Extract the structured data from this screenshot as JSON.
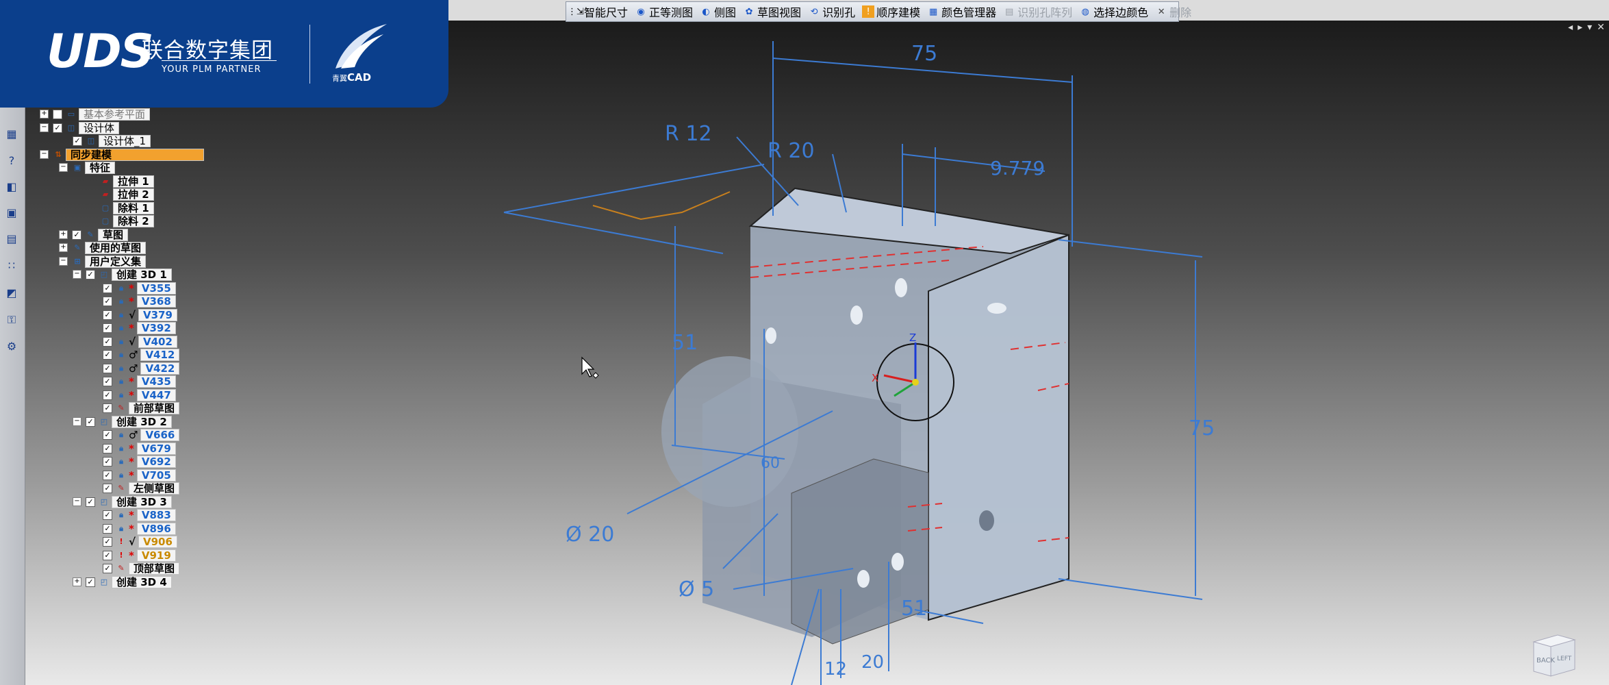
{
  "logo": {
    "brand": "UDS",
    "company_cn": "联合数字集团",
    "tagline": "YOUR PLM PARTNER",
    "product_prefix": "青翼",
    "product": "CAD"
  },
  "toolbar": {
    "items": [
      {
        "label": "智能尺寸",
        "icon": "smart-dimension-icon",
        "enabled": true
      },
      {
        "label": "正等测图",
        "icon": "isometric-view-icon",
        "enabled": true
      },
      {
        "label": "侧图",
        "icon": "side-view-icon",
        "enabled": true
      },
      {
        "label": "草图视图",
        "icon": "sketch-view-icon",
        "enabled": true
      },
      {
        "label": "识别孔",
        "icon": "recognize-hole-icon",
        "enabled": true
      },
      {
        "label": "顺序建模",
        "icon": "ordered-modeling-icon",
        "enabled": true
      },
      {
        "label": "颜色管理器",
        "icon": "color-manager-icon",
        "enabled": true
      },
      {
        "label": "识别孔阵列",
        "icon": "recognize-hole-pattern-icon",
        "enabled": false
      },
      {
        "label": "选择边颜色",
        "icon": "select-edge-color-icon",
        "enabled": true
      },
      {
        "label": "删除",
        "icon": "delete-icon",
        "enabled": false
      }
    ]
  },
  "tree": {
    "base_ref": "基本参考平面",
    "design_body": "设计体",
    "design_body_1": "设计体_1",
    "sync_modeling": "同步建模",
    "features": "特征",
    "extrude1": "拉伸 1",
    "extrude2": "拉伸 2",
    "cut1": "除料 1",
    "cut2": "除料 2",
    "sketch": "草图",
    "used_sketch": "使用的草图",
    "user_defined_set": "用户定义集",
    "create3d1": "创建 3D 1",
    "create3d2": "创建 3D 2",
    "create3d3": "创建 3D 3",
    "create3d4": "创建 3D 4",
    "v355": "V355",
    "v368": "V368",
    "v379": "V379",
    "v392": "V392",
    "v402": "V402",
    "v412": "V412",
    "v422": "V422",
    "v435": "V435",
    "v447": "V447",
    "front_sketch": "前部草图",
    "v666": "V666",
    "v679": "V679",
    "v692": "V692",
    "v705": "V705",
    "left_sketch": "左侧草图",
    "v883": "V883",
    "v896": "V896",
    "v906": "V906",
    "v919": "V919",
    "top_sketch": "顶部草图"
  },
  "dimensions": {
    "d75_top": "75",
    "r12": "R 12",
    "r20": "R 20",
    "d9779": "9.779",
    "d51_left": "51",
    "d75_right": "75",
    "d60": "60",
    "phi20": "Ø 20",
    "phi5": "Ø 5",
    "d51_bottom": "51",
    "d12": "12",
    "d20": "20"
  },
  "axes": {
    "x": "X",
    "z": "Z"
  },
  "navcube": {
    "back": "BACK",
    "left": "LEFT"
  },
  "colors": {
    "brand_blue": "#0b3f8c",
    "dim_blue": "#3c7bd3",
    "sync_highlight": "#f2a12e"
  }
}
